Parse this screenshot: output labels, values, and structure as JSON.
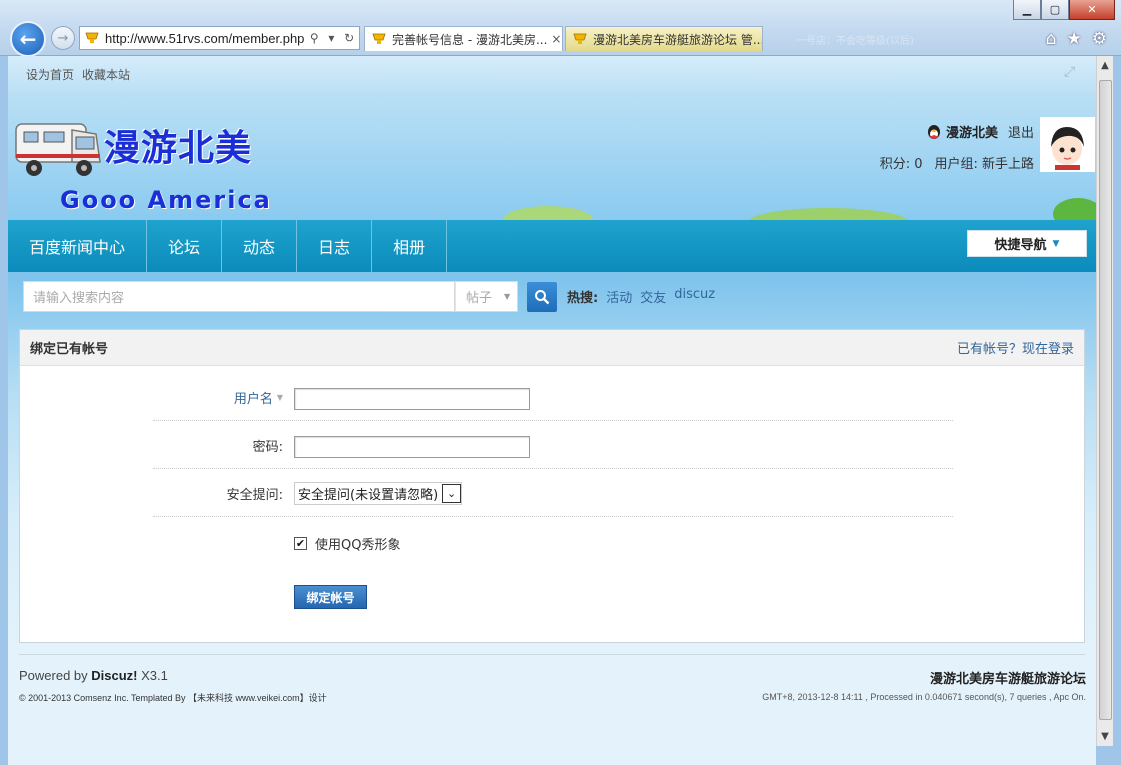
{
  "browser": {
    "url": "http://www.51rvs.com/member.php",
    "tabs": [
      {
        "label": "完善帐号信息 - 漫游北美房...",
        "close": "×"
      },
      {
        "label": "漫游北美房车游艇旅游论坛 管..."
      }
    ],
    "window_buttons": {
      "minimize": "▁",
      "maximize": "▢",
      "close": "✕"
    },
    "ghost_tab": "一号店：不会吃等级(以后)"
  },
  "topbar": {
    "set_home": "设为首页",
    "bookmark": "收藏本站"
  },
  "header": {
    "logo_cn": "漫游北美",
    "logo_en": "Gooo America",
    "username": "漫游北美",
    "logout": "退出",
    "points_label": "积分: 0",
    "group_label": "用户组: 新手上路"
  },
  "nav": {
    "items": [
      "百度新闻中心",
      "论坛",
      "动态",
      "日志",
      "相册"
    ],
    "quick_nav": "快捷导航"
  },
  "search": {
    "placeholder": "请输入搜索内容",
    "type": "帖子",
    "hot_label": "热搜:",
    "hot_links": [
      "活动",
      "交友",
      "discuz"
    ]
  },
  "form": {
    "title": "绑定已有帐号",
    "login_link": "已有帐号？现在登录",
    "username_label": "用户名",
    "password_label": "密码:",
    "question_label": "安全提问:",
    "question_value": "安全提问(未设置请忽略)",
    "qq_show_label": "使用QQ秀形象",
    "qq_show_checked": true,
    "submit": "绑定帐号"
  },
  "footer": {
    "powered_prefix": "Powered by ",
    "powered_brand": "Discuz!",
    "powered_version": " X3.1",
    "copyright": "© 2001-2013 Comsenz Inc.  Templated By 【未来科技 www.veikei.com】设计",
    "site_name": "漫游北美房车游艇旅游论坛",
    "stats": "GMT+8, 2013-12-8 14:11 , Processed in 0.040671 second(s), 7 queries , Apc On."
  }
}
